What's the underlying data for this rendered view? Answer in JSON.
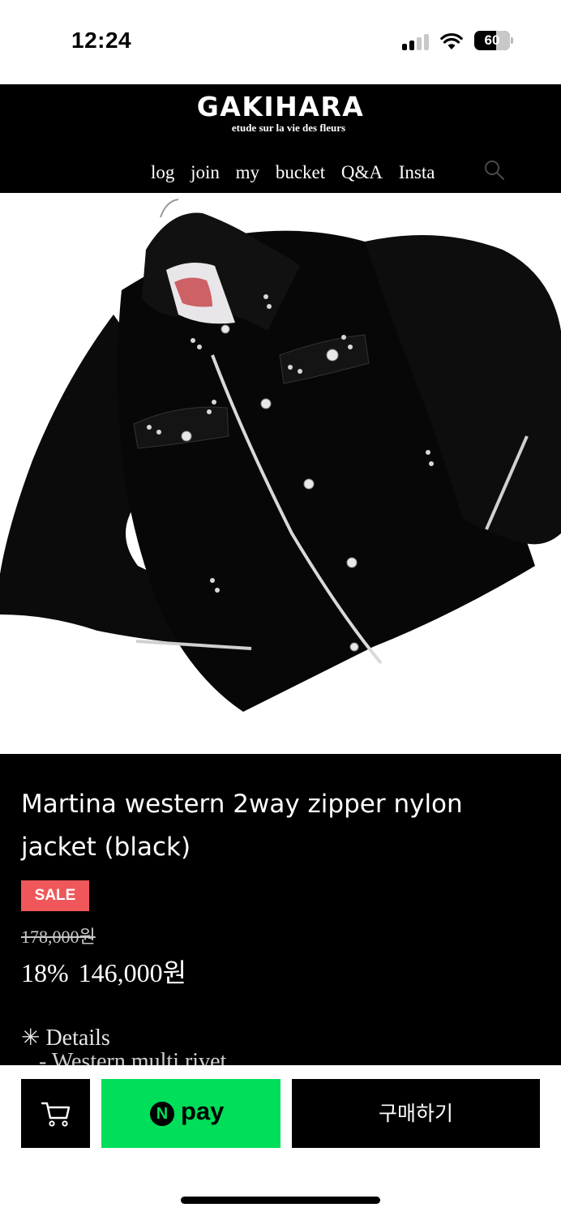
{
  "status_bar": {
    "time": "12:24",
    "battery": "60",
    "icons": [
      "signal-icon",
      "wifi-icon",
      "battery-icon"
    ]
  },
  "header": {
    "logo": "GAKIHARA",
    "tagline": "etude sur la vie des fleurs",
    "nav": [
      "log",
      "join",
      "my",
      "bucket",
      "Q&A",
      "Insta"
    ],
    "search_icon": "search-icon"
  },
  "product": {
    "image_icon": "black-jacket-photo",
    "title": "Martina western 2way zipper nylon jacket (black)",
    "badge": "SALE",
    "original_price": "178,000원",
    "discount": "18%",
    "price": "146,000원",
    "details_heading": "✳ Details",
    "details_line": "- Western multi rivet"
  },
  "bottom_bar": {
    "cart_icon": "cart-icon",
    "npay_mark": "N",
    "npay_label": "pay",
    "buy_label": "구매하기"
  },
  "colors": {
    "sale_badge": "#f0575a",
    "npay_green": "#00de5a",
    "header_bg": "#000000"
  }
}
